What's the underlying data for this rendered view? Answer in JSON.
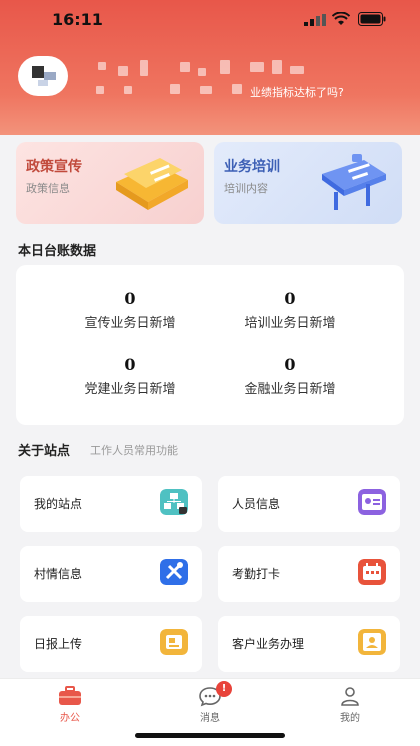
{
  "status_bar": {
    "time": "16:11"
  },
  "header": {
    "subtitle": "业绩指标达标了吗?"
  },
  "top_cards": [
    {
      "title": "政策宣传",
      "subtitle": "政策信息"
    },
    {
      "title": "业务培训",
      "subtitle": "培训内容"
    }
  ],
  "ledger": {
    "title": "本日台账数据",
    "stats": [
      {
        "value": "0",
        "label": "宣传业务日新增"
      },
      {
        "value": "0",
        "label": "培训业务日新增"
      },
      {
        "value": "0",
        "label": "党建业务日新增"
      },
      {
        "value": "0",
        "label": "金融业务日新增"
      }
    ]
  },
  "about": {
    "title": "关于站点",
    "subtitle": "工作人员常用功能",
    "items": [
      {
        "label": "我的站点",
        "icon": "site-icon",
        "color": "#4fc1c2"
      },
      {
        "label": "人员信息",
        "icon": "id-card-icon",
        "color": "#8c62e0"
      },
      {
        "label": "村情信息",
        "icon": "tools-icon",
        "color": "#2f6fe8"
      },
      {
        "label": "考勤打卡",
        "icon": "calendar-icon",
        "color": "#e8533b"
      },
      {
        "label": "日报上传",
        "icon": "report-icon",
        "color": "#f2b53b"
      },
      {
        "label": "客户业务办理",
        "icon": "customer-icon",
        "color": "#f2b53b"
      }
    ]
  },
  "tabbar": {
    "tabs": [
      {
        "label": "办公",
        "icon": "briefcase-icon",
        "active": true
      },
      {
        "label": "消息",
        "icon": "message-icon",
        "badge": "!"
      },
      {
        "label": "我的",
        "icon": "user-icon"
      }
    ]
  },
  "colors": {
    "accent": "#e8574a",
    "header_gradient_end": "#f3937b"
  }
}
